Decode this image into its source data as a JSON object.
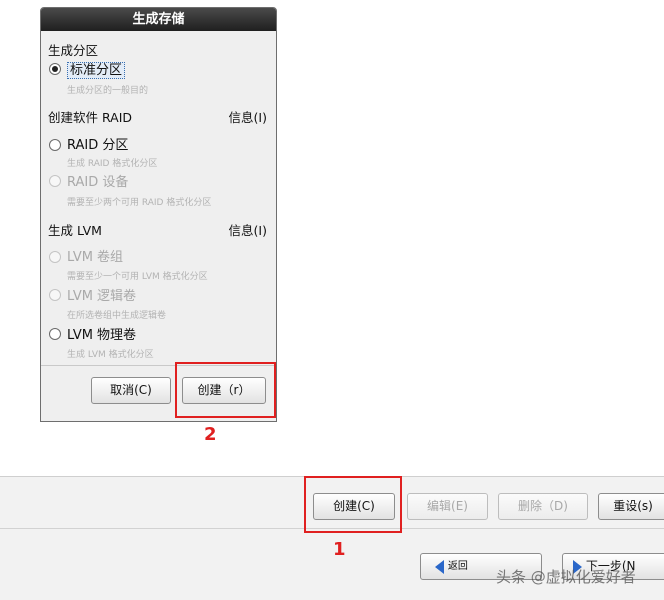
{
  "dialog": {
    "title": "生成存储",
    "section_partition": "生成分区",
    "standard_partition": {
      "label": "标准分区",
      "desc": "生成分区的一般目的"
    },
    "section_raid": "创建软件 RAID",
    "raid_info_link": "信息(I)",
    "raid_partition": {
      "label": "RAID 分区",
      "desc": "生成 RAID 格式化分区"
    },
    "raid_device": {
      "label": "RAID 设备",
      "desc": "需要至少两个可用 RAID 格式化分区"
    },
    "section_lvm": "生成 LVM",
    "lvm_info_link": "信息(I)",
    "lvm_volume_group": {
      "label": "LVM 卷组",
      "desc": "需要至少一个可用 LVM 格式化分区"
    },
    "lvm_logical_volume": {
      "label": "LVM 逻辑卷",
      "desc": "在所选卷组中生成逻辑卷"
    },
    "lvm_physical_volume": {
      "label": "LVM 物理卷",
      "desc": "生成 LVM 格式化分区"
    },
    "cancel_label": "取消(C)",
    "create_label": "创建（r）"
  },
  "toolbar": {
    "create_label": "创建(C)",
    "edit_label": "编辑(E)",
    "delete_label": "删除（D)",
    "reset_label": "重设(s)"
  },
  "nav": {
    "back_label": "返回",
    "next_label": "下一步(N"
  },
  "annotations": {
    "marker_1": "1",
    "marker_2": "2"
  },
  "watermark": "头条 @虚拟化爱好者",
  "colors": {
    "highlight": "#e02020",
    "accent": "#2a67c9"
  }
}
